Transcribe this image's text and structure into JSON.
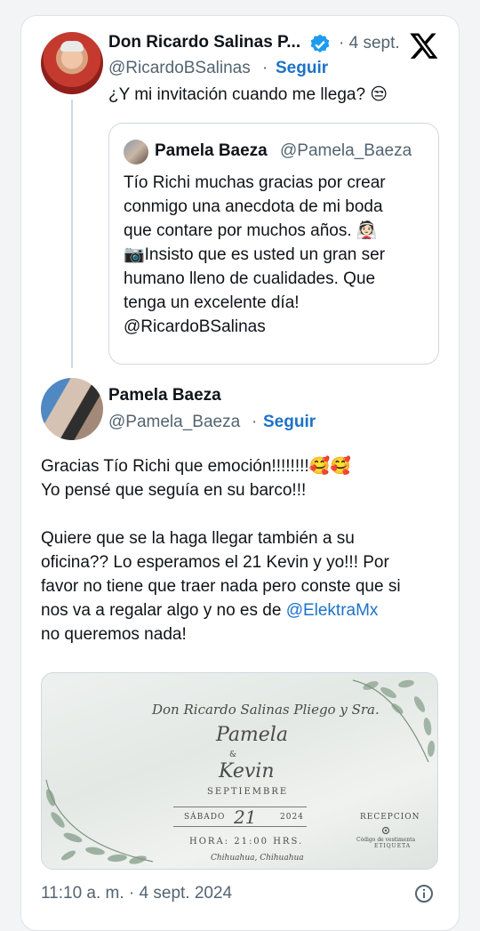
{
  "tweet": {
    "author_name": "Don Ricardo Salinas P...",
    "author_handle": "@RicardoBSalinas",
    "date": "· 4 sept.",
    "follow": "Seguir",
    "text": "¿Y mi invitación cuando me llega? 😒"
  },
  "quote": {
    "author_name": "Pamela Baeza",
    "author_handle": "@Pamela_Baeza",
    "lines": [
      "Tío Richi muchas gracias por crear",
      "conmigo una anecdota de mi boda",
      "que contare por muchos años. 👰🏻",
      "📷Insisto que es usted un gran ser",
      "humano lleno de cualidades. Que",
      "tenga un excelente día!",
      "@RicardoBSalinas"
    ]
  },
  "reply": {
    "author_name": "Pamela Baeza",
    "author_handle": "@Pamela_Baeza",
    "dot": "·",
    "follow": "Seguir",
    "lines": [
      "Gracias Tío Richi que emoción!!!!!!!!🥰🥰",
      "Yo pensé que seguía en su barco!!!",
      "",
      "Quiere que se la haga llegar también a su",
      "oficina?? Lo esperamos el 21 Kevin y yo!!! Por",
      "favor no tiene que traer nada pero conste que si",
      "nos va a regalar algo y no es de"
    ],
    "mention": "@ElektraMx",
    "last_line": "no queremos nada!"
  },
  "invitation": {
    "host": "Don Ricardo Salinas Pliego y Sra.",
    "bride": "Pamela",
    "amp": "&",
    "groom": "Kevin",
    "month": "SEPTIEMBRE",
    "day_name": "SÁBADO",
    "day_num": "21",
    "year": "2024",
    "time": "HORA: 21:00 HRS.",
    "place": "Chihuahua, Chihuahua",
    "reception": "RECEPCION",
    "dress_code_1": "Código de vestimenta",
    "dress_code_2": "ETIQUETA"
  },
  "footer": {
    "timestamp": "11:10 a. m. · 4 sept. 2024"
  },
  "colors": {
    "link": "#1d72c8",
    "verified": "#1d9bf0",
    "secondary": "#536471"
  },
  "icons": [
    "verified-badge-icon",
    "x-logo-icon",
    "info-icon",
    "camera-icon",
    "gear-icon"
  ]
}
